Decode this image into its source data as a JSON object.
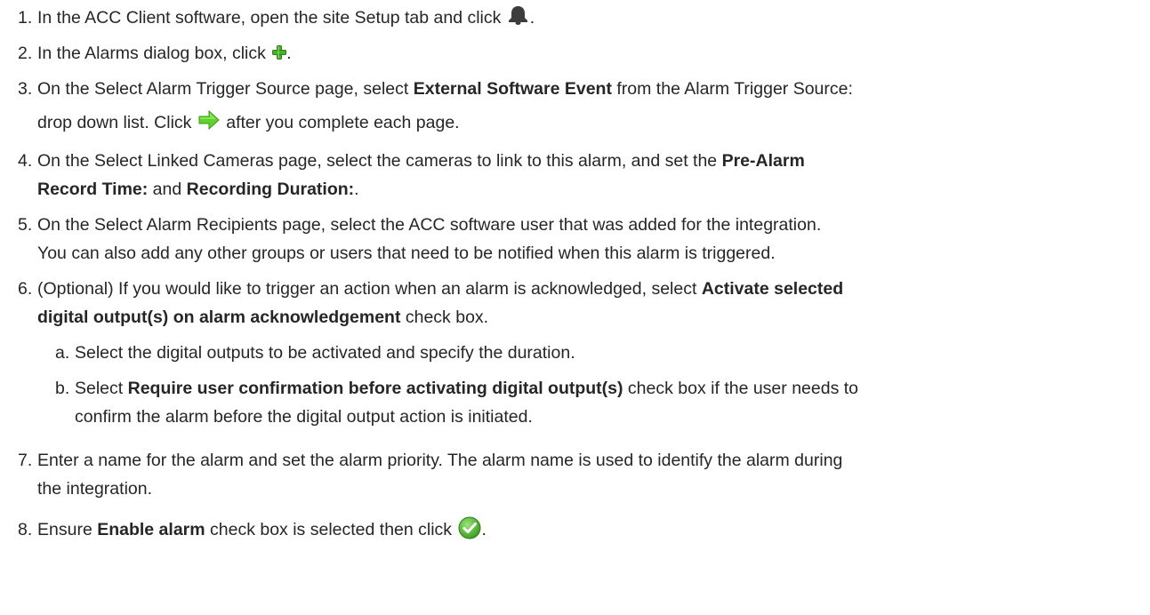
{
  "steps": [
    {
      "num": "1.",
      "parts": [
        "In the ACC Client software, open the site Setup tab and click ",
        "."
      ]
    },
    {
      "num": "2.",
      "parts": [
        "In the Alarms dialog box, click ",
        "."
      ]
    },
    {
      "num": "3.",
      "line1_a": "On the Select Alarm Trigger Source page, select ",
      "line1_b": "External Software Event",
      "line1_c": " from the Alarm Trigger Source:",
      "line2_a": "drop down list. Click ",
      "line2_b": " after you complete each page."
    },
    {
      "num": "4.",
      "a": "On the Select Linked Cameras page, select the cameras to link to this alarm, and set the ",
      "b": "Pre-Alarm",
      "c": "Record Time:",
      "d": " and ",
      "e": "Recording Duration:",
      "f": "."
    },
    {
      "num": "5.",
      "line1": "On the Select Alarm Recipients page, select the ACC software user that was added for the integration.",
      "line2": "You can also add any other groups or users that need to be notified when this alarm is triggered."
    },
    {
      "num": "6.",
      "a": "(Optional) If you would like to trigger an action when an alarm is acknowledged, select ",
      "b": "Activate selected",
      "c": "digital output(s) on alarm acknowledgement",
      "d": " check box."
    },
    {
      "num": "a.",
      "text": "Select the digital outputs to be activated and specify the duration."
    },
    {
      "num": "b.",
      "a": "Select ",
      "b": "Require user confirmation before activating digital output(s)",
      "c": " check box if the user needs to",
      "line2": "confirm the alarm before the digital output action is initiated."
    },
    {
      "num": "7.",
      "line1": "Enter a name for the alarm and set the alarm priority. The alarm name is used to identify the alarm during",
      "line2": "the integration."
    },
    {
      "num": "8.",
      "a": "Ensure ",
      "b": "Enable alarm",
      "c": " check box is selected then click ",
      "d": "."
    }
  ],
  "icons": {
    "bell": "bell-icon",
    "plus": "plus-icon",
    "next": "next-arrow-icon",
    "confirm": "checkmark-icon"
  },
  "colors": {
    "text": "#262626",
    "bell": "#3d3d3d",
    "plus": "#4caf2a",
    "arrow": "#5ed32b",
    "check": "#4fb52e"
  }
}
